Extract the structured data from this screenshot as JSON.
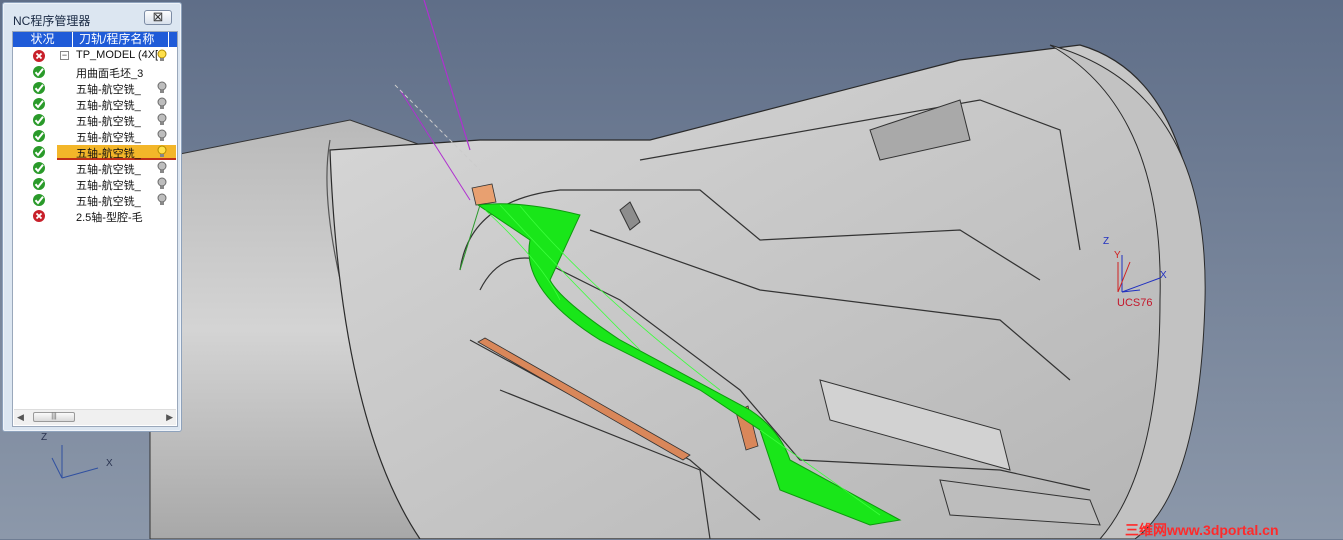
{
  "panel": {
    "title": "NC程序管理器",
    "close_label": "⊠",
    "columns": [
      "状况",
      "刀轨/程序名称",
      ""
    ],
    "rows": [
      {
        "status": "error",
        "name": "TP_MODEL (4X[",
        "expander": "−",
        "bulb": "yellow"
      },
      {
        "status": "ok",
        "name": "用曲面毛坯_3",
        "bulb": "none"
      },
      {
        "status": "ok",
        "name": "五轴-航空铣_",
        "bulb": "gray"
      },
      {
        "status": "ok",
        "name": "五轴-航空铣_",
        "bulb": "gray"
      },
      {
        "status": "ok",
        "name": "五轴-航空铣_",
        "bulb": "gray"
      },
      {
        "status": "ok",
        "name": "五轴-航空铣_",
        "bulb": "gray"
      },
      {
        "status": "ok",
        "name": "五轴-航空铣_",
        "bulb": "yellow",
        "selected": true
      },
      {
        "status": "ok",
        "name": "五轴-航空铣_",
        "bulb": "gray"
      },
      {
        "status": "ok",
        "name": "五轴-航空铣_",
        "bulb": "gray"
      },
      {
        "status": "ok",
        "name": "五轴-航空铣_",
        "bulb": "gray"
      },
      {
        "status": "error",
        "name": "2.5轴-型腔-毛",
        "bulb": "none"
      }
    ],
    "scroll_left": "◀",
    "scroll_right": "▶",
    "scroll_thumb": "|||"
  },
  "triad": {
    "z": "Z",
    "x": "X"
  },
  "ucs": {
    "z": "Z",
    "y": "Y",
    "x": "X",
    "label": "UCS76"
  },
  "watermark": "三维网www.3dportal.cn",
  "colors": {
    "background": "#6f7d93",
    "toolpath": "#19e619",
    "selection": "#f3b629",
    "part": "#c9c9c9"
  }
}
